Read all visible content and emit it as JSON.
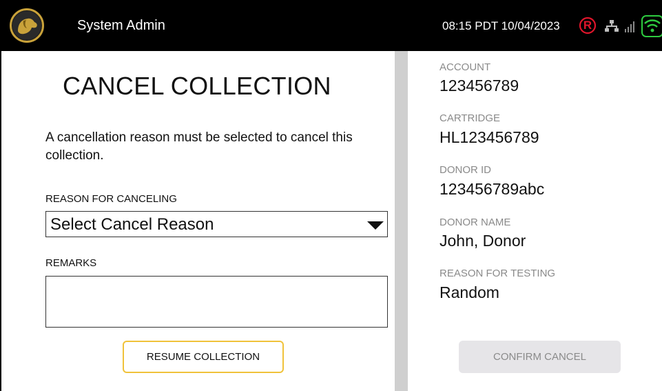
{
  "header": {
    "app_title": "System Admin",
    "datetime": "08:15 PDT 10/04/2023",
    "registered_mark": "R",
    "icons": [
      "dog-logo-icon",
      "registered-icon",
      "network-icon",
      "signal-icon",
      "wifi-icon"
    ],
    "accent_color": "#c9a23a",
    "registered_color": "#e0152b",
    "wifi_color": "#2ecc40"
  },
  "form": {
    "title": "CANCEL COLLECTION",
    "instruction": "A cancellation reason must be selected to cancel this collection.",
    "reason_label": "REASON FOR CANCELING",
    "reason_selected": "Select Cancel Reason",
    "remarks_label": "REMARKS",
    "remarks_value": "",
    "resume_button": "RESUME COLLECTION"
  },
  "details": {
    "account_label": "ACCOUNT",
    "account_value": "123456789",
    "cartridge_label": "CARTRIDGE",
    "cartridge_value": "HL123456789",
    "donor_id_label": "DONOR ID",
    "donor_id_value": "123456789abc",
    "donor_name_label": "DONOR NAME",
    "donor_name_value": "John, Donor",
    "reason_label": "REASON FOR TESTING",
    "reason_value": "Random",
    "confirm_button": "CONFIRM CANCEL"
  }
}
